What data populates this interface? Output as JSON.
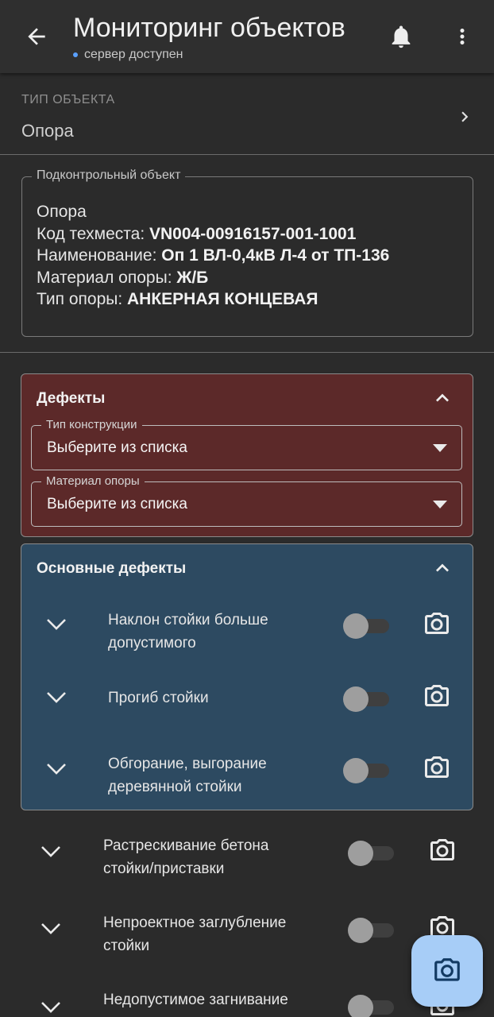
{
  "appbar": {
    "title": "Мониторинг объектов",
    "status": "сервер доступен",
    "status_color": "#5aa0ff",
    "icons": [
      "back-arrow-icon",
      "bell-icon",
      "more-vert-icon"
    ]
  },
  "object_type": {
    "caption": "ТИП ОБЪЕКТА",
    "value": "Опора"
  },
  "controlled_object": {
    "legend": "Подконтрольный объект",
    "name": "Опора",
    "lines": [
      {
        "label": "Код техместа: ",
        "value": "VN004-00916157-001-1001"
      },
      {
        "label": "Наименование: ",
        "value": "Оп 1 ВЛ-0,4кВ Л-4 от ТП-136"
      },
      {
        "label": "Материал опоры: ",
        "value": "Ж/Б"
      },
      {
        "label": "Тип опоры: ",
        "value": "АНКЕРНАЯ КОНЦЕВАЯ"
      }
    ]
  },
  "defects": {
    "title": "Дефекты",
    "color": "#5c2929",
    "selects": [
      {
        "label": "Тип конструкции",
        "value": "Выберите из списка"
      },
      {
        "label": "Материал опоры",
        "value": "Выберите из списка"
      }
    ]
  },
  "main_defects": {
    "title": "Основные дефекты",
    "color": "#2d4a61",
    "items": [
      {
        "line1": "Наклон стойки больше",
        "line2": "допустимого",
        "enabled": false
      },
      {
        "line1": "Прогиб стойки",
        "line2": "",
        "enabled": false
      },
      {
        "line1": "Обгорание, выгорание",
        "line2": "деревянной стойки",
        "enabled": false
      }
    ]
  },
  "other_defects": [
    {
      "line1": "Растрескивание бетона",
      "line2": "стойки/приставки",
      "enabled": false
    },
    {
      "line1": "Непроектное заглубление",
      "line2": "стойки",
      "enabled": false
    },
    {
      "line1": "Недопустимое загнивание",
      "line2": "",
      "enabled": false
    }
  ],
  "fab": {
    "icon": "camera-icon",
    "color": "#a7cdf7"
  }
}
